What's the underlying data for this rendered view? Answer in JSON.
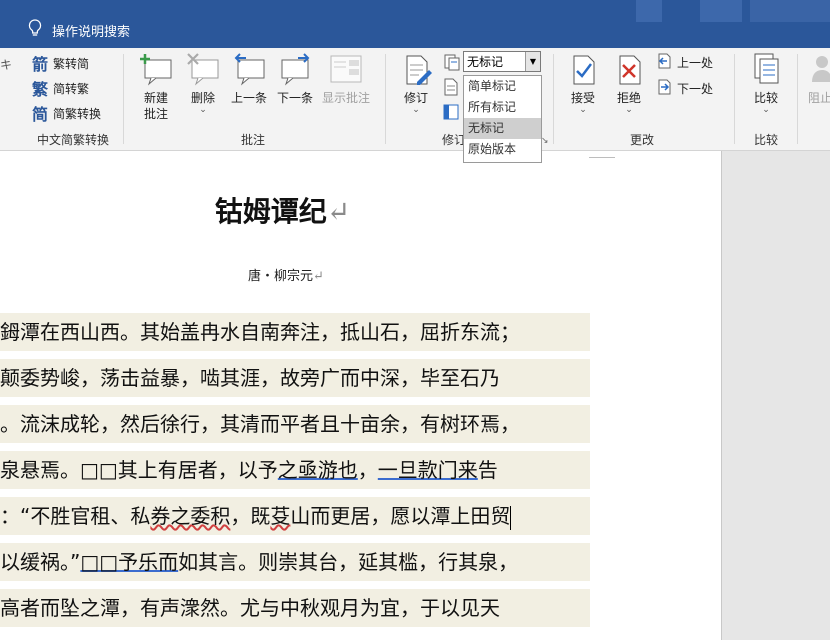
{
  "titlebar": {
    "search_label": "操作说明搜索"
  },
  "ribbon": {
    "chinese_conversion": {
      "items": [
        "繁转简",
        "简转繁",
        "简繁转换"
      ],
      "group_label": "中文简繁转换"
    },
    "comments": {
      "new_comment": [
        "新建",
        "批注"
      ],
      "delete": "删除",
      "previous": "上一条",
      "next": "下一条",
      "show_comments": "显示批注",
      "group_label": "批注"
    },
    "tracking": {
      "track_changes": "修订",
      "markup_select_value": "无标记",
      "markup_options": [
        "简单标记",
        "所有标记",
        "无标记",
        "原始版本"
      ],
      "group_label_partial": "修订"
    },
    "changes": {
      "accept": "接受",
      "reject": "拒绝",
      "previous": "上一处",
      "next": "下一处",
      "group_label": "更改"
    },
    "compare": {
      "compare": "比较",
      "group_label": "比较"
    },
    "protect": {
      "block_partial": "阻止"
    }
  },
  "document": {
    "title": "钴姆谭纪",
    "author": "唐・柳宗元",
    "lines": [
      {
        "t": [
          {
            "s": "鉧潭在西山西。其始盖冉水自南奔注，抵山石，屈折东流；"
          }
        ]
      },
      {
        "t": [
          {
            "s": "颠委势峻，荡击益暴，啮其涯，故旁广而中深，毕至石乃"
          }
        ]
      },
      {
        "t": [
          {
            "s": "。流沫成轮，然后徐行，其清而平者且十亩余，有树环焉，"
          }
        ]
      },
      {
        "t": [
          {
            "s": "泉悬焉。□□其上有居者，以予"
          },
          {
            "s": "之亟游也",
            "u": true
          },
          {
            "s": "，"
          },
          {
            "s": "一旦款门来",
            "u": true
          },
          {
            "s": "告"
          }
        ]
      },
      {
        "t": [
          {
            "s": "：“不胜官租、私"
          },
          {
            "s": "券之委积",
            "w": true
          },
          {
            "s": "，既"
          },
          {
            "s": "芟",
            "w": true
          },
          {
            "s": "山而更居，愿以潭上田贸"
          },
          {
            "c": true
          }
        ]
      },
      {
        "t": [
          {
            "s": "以缓祸。”"
          },
          {
            "s": "□□予乐而",
            "u": true
          },
          {
            "s": "如其言。则崇其台，延其槛，行其泉，"
          }
        ]
      },
      {
        "t": [
          {
            "s": "高者而坠之潭，有声潨然。尤与中秋观月为宜，于以见天"
          }
        ]
      }
    ]
  }
}
